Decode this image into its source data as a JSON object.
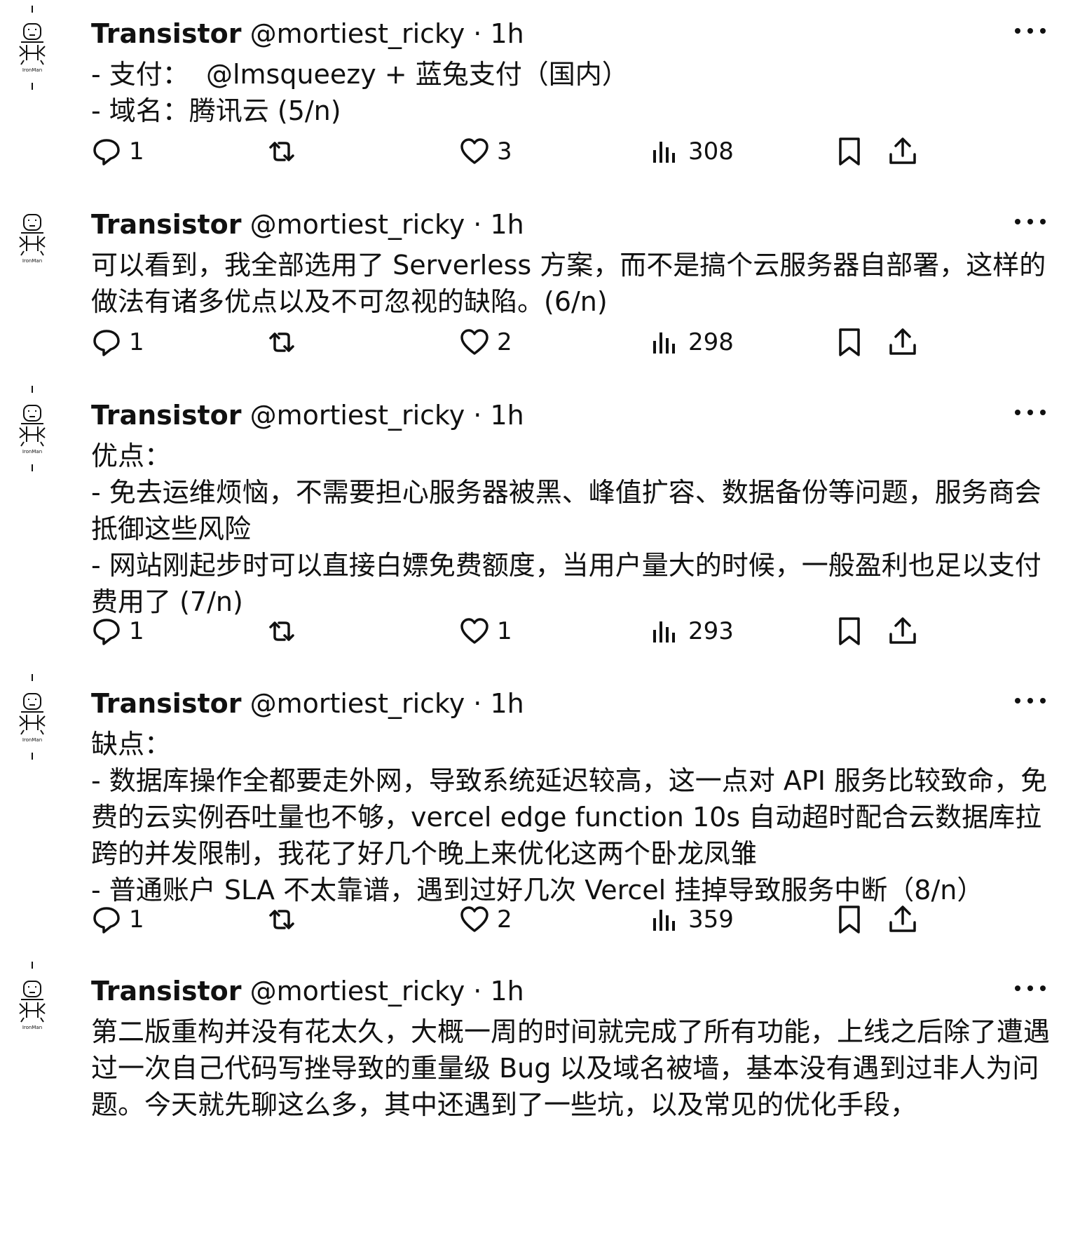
{
  "tweets": [
    {
      "name": "Transistor",
      "handle": "@mortiest_ricky",
      "separator": "·",
      "time": "1h",
      "body": "- 支付：  @lmsqueezy + 蓝兔支付（国内）\n- 域名：腾讯云 (5/n)",
      "replies": "1",
      "retweets": "",
      "likes": "3",
      "views": "308"
    },
    {
      "name": "Transistor",
      "handle": "@mortiest_ricky",
      "separator": "·",
      "time": "1h",
      "body": "可以看到，我全部选用了 Serverless 方案，而不是搞个云服务器自部署，这样的做法有诸多优点以及不可忽视的缺陷。(6/n)",
      "replies": "1",
      "retweets": "",
      "likes": "2",
      "views": "298"
    },
    {
      "name": "Transistor",
      "handle": "@mortiest_ricky",
      "separator": "·",
      "time": "1h",
      "body": "优点：\n- 免去运维烦恼，不需要担心服务器被黑、峰值扩容、数据备份等问题，服务商会抵御这些风险\n- 网站刚起步时可以直接白嫖免费额度，当用户量大的时候，一般盈利也足以支付费用了 (7/n)",
      "replies": "1",
      "retweets": "",
      "likes": "1",
      "views": "293"
    },
    {
      "name": "Transistor",
      "handle": "@mortiest_ricky",
      "separator": "·",
      "time": "1h",
      "body": "缺点：\n- 数据库操作全都要走外网，导致系统延迟较高，这一点对 API 服务比较致命，免费的云实例吞吐量也不够，vercel edge function 10s 自动超时配合云数据库拉跨的并发限制，我花了好几个晚上来优化这两个卧龙凤雏\n- 普通账户 SLA 不太靠谱，遇到过好几次 Vercel 挂掉导致服务中断（8/n）",
      "replies": "1",
      "retweets": "",
      "likes": "2",
      "views": "359"
    },
    {
      "name": "Transistor",
      "handle": "@mortiest_ricky",
      "separator": "·",
      "time": "1h",
      "body": "第二版重构并没有花太久，大概一周的时间就完成了所有功能，上线之后除了遭遇过一次自己代码写挫导致的重量级 Bug 以及域名被墙，基本没有遇到过非人为问题。今天就先聊这么多，其中还遇到了一些坑，以及常见的优化手段，",
      "replies": "",
      "retweets": "",
      "likes": "",
      "views": ""
    }
  ],
  "icons": {
    "avatar": "pixel-robot-avatar-icon",
    "more": "more-dots-icon",
    "reply": "reply-bubble-icon",
    "retweet": "retweet-arrows-icon",
    "like": "heart-icon",
    "views": "views-bars-icon",
    "bookmark": "bookmark-icon",
    "share": "share-upload-icon"
  },
  "colors": {
    "text": "#111111",
    "background": "#ffffff"
  }
}
